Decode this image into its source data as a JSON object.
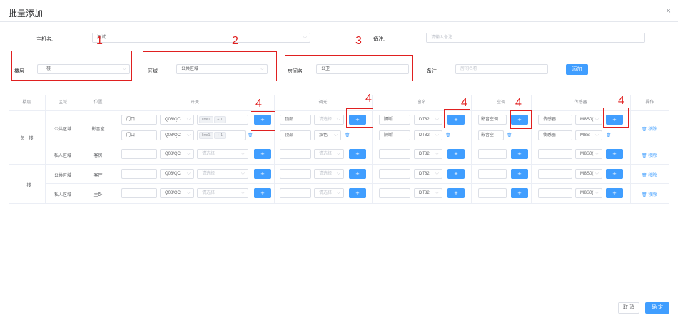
{
  "dialog": {
    "title": "批量添加",
    "close_icon": "×"
  },
  "top_form": {
    "host_label": "主机名:",
    "host_value": "测试",
    "remark_label": "备注:",
    "remark_placeholder": "请输入备注"
  },
  "filter_form": {
    "floor_label": "楼层",
    "floor_value": "一楼",
    "area_label": "区域",
    "area_value": "公共区域",
    "room_label": "房间名",
    "room_value": "公卫",
    "remark_label": "备注",
    "remark_placeholder": "房间名称",
    "add_label": "添加"
  },
  "annotations": [
    "1",
    "2",
    "3",
    "4",
    "4",
    "4",
    "4",
    "4"
  ],
  "table": {
    "headers": [
      "楼层",
      "区域",
      "位置",
      "开关",
      "调光",
      "窗帘",
      "空调",
      "传感器",
      "操作"
    ],
    "floors": [
      "负一楼",
      "一楼"
    ],
    "rows": [
      {
        "area": "公共区域",
        "position": "影音室"
      },
      {
        "area": "私人区域",
        "position": "客房"
      },
      {
        "area": "公共区域",
        "position": "客厅"
      },
      {
        "area": "私人区域",
        "position": "主卧"
      }
    ],
    "switch": {
      "name1": "门口",
      "model1": "Q08/QC",
      "line_tag": "line1",
      "count_tag": "+ 1",
      "name2": "门口",
      "model2": "Q08/QC",
      "line_tag2": "line1",
      "count_tag2": "+ 1",
      "model": "Q08/QC",
      "select_placeholder": "请选择"
    },
    "dimmer": {
      "name1": "顶部",
      "select_placeholder": "请选择",
      "name2": "顶部",
      "color_value": "双色"
    },
    "curtain": {
      "name1": "隔断",
      "model1": "DT82",
      "name2": "隔断",
      "model2": "DT82",
      "model": "DT82"
    },
    "ac": {
      "name1": "影音空调",
      "name2": "影音空"
    },
    "sensor": {
      "name1": "传感器",
      "model1": "MBS0(",
      "name2": "传感器",
      "model2": "MBS",
      "model": "MBS0("
    },
    "plus_label": "+",
    "delete_label": "移除",
    "trash_icon": "🗑"
  },
  "footer": {
    "cancel_label": "取 消",
    "confirm_label": "确 定"
  },
  "colors": {
    "primary": "#409eff",
    "annotation": "#e02020",
    "border": "#dcdfe6"
  }
}
